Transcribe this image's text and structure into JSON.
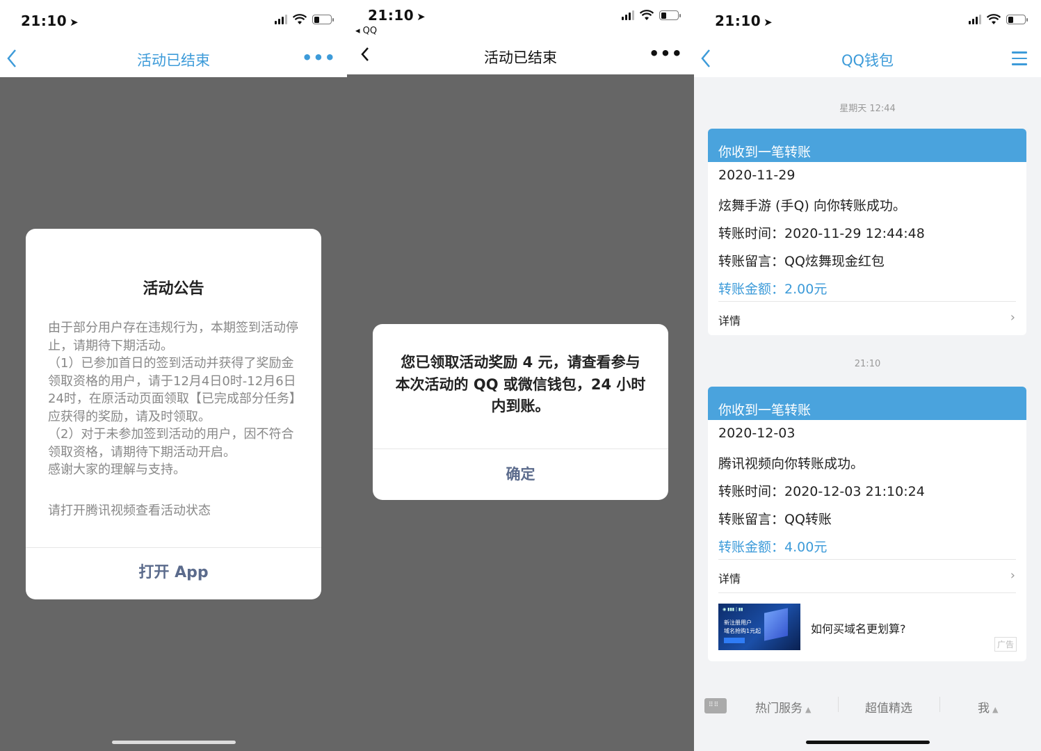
{
  "panel1": {
    "status_time": "21:10",
    "nav_title": "活动已结束",
    "nav_more": "•••",
    "dialog": {
      "title": "活动公告",
      "body": [
        "由于部分用户存在违规行为，本期签到活动停止，请期待下期活动。",
        "（1）已参加首日的签到活动并获得了奖励金领取资格的用户，请于12月4日0时-12月6日24时，在原活动页面领取【已完成部分任务】应获得的奖励，请及时领取。",
        "（2）对于未参加签到活动的用户，因不符合领取资格，请期待下期活动开启。",
        "感谢大家的理解与支持。"
      ],
      "note": "请打开腾讯视频查看活动状态",
      "button": "打开 App"
    }
  },
  "panel2": {
    "status_time": "21:10",
    "back_app": "◂ QQ",
    "nav_title": "活动已结束",
    "nav_more": "•••",
    "dialog": {
      "text": "您已领取活动奖励 4 元，请查看参与本次活动的 QQ 或微信钱包，24 小时内到账。",
      "button": "确定"
    }
  },
  "panel3": {
    "status_time": "21:10",
    "nav_title": "QQ钱包",
    "messages": [
      {
        "timestamp": "星期天 12:44",
        "header": "你收到一笔转账",
        "date": "2020-11-29",
        "line": "炫舞手游 (手Q) 向你转账成功。",
        "time_label": "转账时间：",
        "time_value": "2020-11-29 12:44:48",
        "msg_label": "转账留言：",
        "msg_value": "QQ炫舞现金红包",
        "amount_label": "转账金额：",
        "amount_value": "2.00元",
        "detail": "详情"
      },
      {
        "timestamp": "21:10",
        "header": "你收到一笔转账",
        "date": "2020-12-03",
        "line": "腾讯视频向你转账成功。",
        "time_label": "转账时间：",
        "time_value": "2020-12-03 21:10:24",
        "msg_label": "转账留言：",
        "msg_value": "QQ转账",
        "amount_label": "转账金额：",
        "amount_value": "4.00元",
        "detail": "详情"
      }
    ],
    "ad": {
      "text": "如何买域名更划算?",
      "tag": "广告",
      "image_line1": "新注册用户",
      "image_line2": "域名抢购1元起"
    },
    "bottom_tabs": [
      "热门服务",
      "超值精选",
      "我"
    ]
  },
  "colors": {
    "accent_blue": "#3d9bd9",
    "card_header": "#4aa3dd",
    "dim_overlay": "#666666",
    "button_text": "#5b6b8c"
  }
}
